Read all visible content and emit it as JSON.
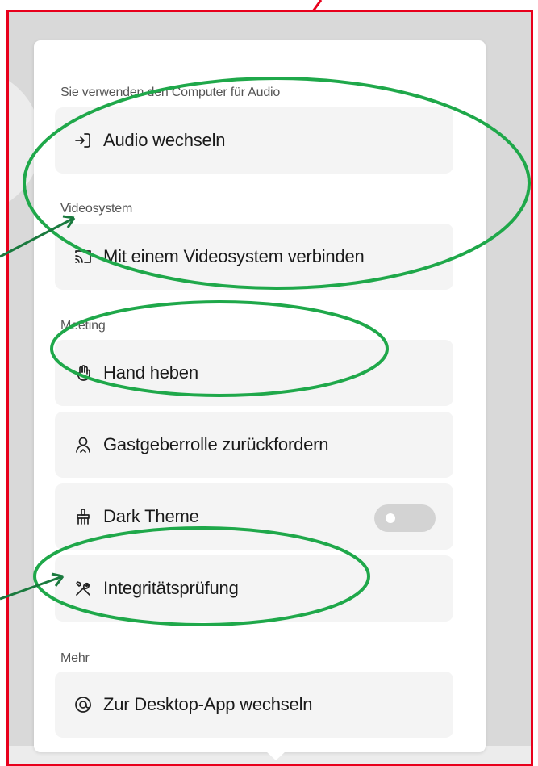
{
  "sections": {
    "audio": "Sie verwenden den Computer für Audio",
    "video": "Videosystem",
    "meeting": "Meeting",
    "more": "Mehr"
  },
  "items": {
    "audio_switch": "Audio wechseln",
    "video_connect": "Mit einem Videosystem verbinden",
    "raise_hand": "Hand heben",
    "reclaim_host": "Gastgeberrolle zurückfordern",
    "dark_theme": "Dark Theme",
    "integrity_check": "Integritätsprüfung",
    "desktop_app": "Zur Desktop-App wechseln"
  },
  "toggles": {
    "dark_theme_on": false
  },
  "icons": {
    "audio_switch": "audio-switch-icon",
    "video_connect": "cast-icon",
    "raise_hand": "hand-icon",
    "reclaim_host": "host-person-icon",
    "dark_theme": "brush-icon",
    "integrity_check": "tools-icon",
    "desktop_app": "desktop-app-icon"
  },
  "colors": {
    "frame_border": "#e8001c",
    "annotation_ellipse": "#1fa84a",
    "annotation_arrow": "#1a7a3e"
  }
}
